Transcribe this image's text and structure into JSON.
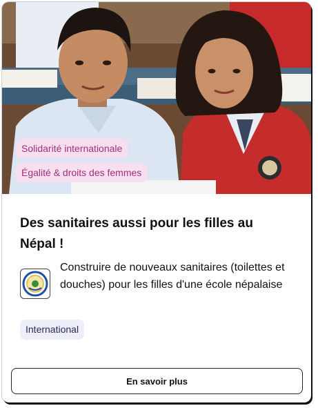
{
  "card": {
    "image_alt": "Photo of two Nepalese schoolchildren in uniforms",
    "tags": [
      "Solidarité internationale",
      "Égalité & droits des femmes"
    ],
    "title": "Des sanitaires aussi pour les filles au Népal !",
    "organization_logo": "emblem-logo",
    "description": "Construire de nouveaux sanitaires (toilettes et douches) pour les filles d'une école népalaise",
    "category_chip": "International",
    "cta_label": "En savoir plus"
  },
  "colors": {
    "tag_bg": "#f8dff0",
    "tag_text": "#a0307a",
    "chip_bg": "#eeeefb",
    "chip_text": "#2a2a5a"
  }
}
